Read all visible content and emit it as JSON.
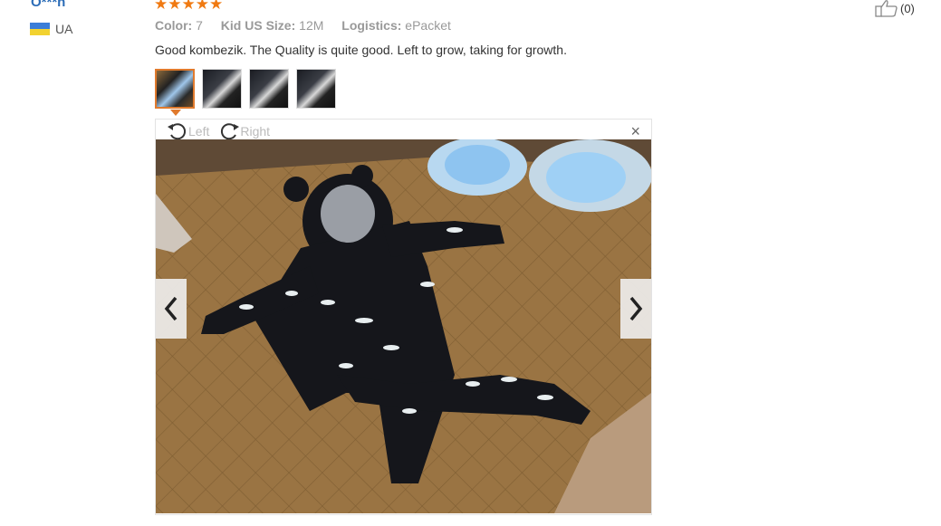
{
  "review": {
    "username": "O***n",
    "country": "UA",
    "rating": 5,
    "meta": {
      "color_label": "Color:",
      "color_value": "7",
      "size_label": "Kid US Size:",
      "size_value": "12M",
      "logistics_label": "Logistics:",
      "logistics_value": "ePacket"
    },
    "text": "Good kombezik. The Quality is quite good. Left to grow, taking for growth.",
    "likes": "(0)"
  },
  "viewer": {
    "rotate_left": "Left",
    "rotate_right": "Right",
    "close": "×",
    "thumbnails": 4,
    "active_thumbnail": 1
  },
  "colors": {
    "accent": "#f07a12",
    "username": "#2b6cb7"
  }
}
